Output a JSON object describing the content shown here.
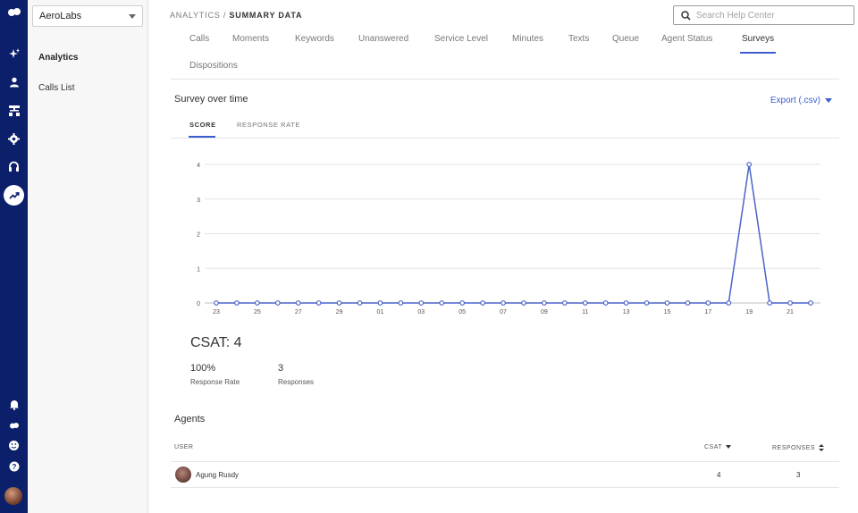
{
  "org_selector": {
    "value": "AeroLabs"
  },
  "sidebar": {
    "items": [
      {
        "label": "Analytics",
        "active": true
      },
      {
        "label": "Calls List",
        "active": false
      }
    ]
  },
  "rail_icons": [
    "logo-icon",
    "sparkle-icon",
    "user-icon",
    "org-chart-icon",
    "settings-icon",
    "headset-icon",
    "trending-icon",
    "bell-icon",
    "logo-small-icon",
    "smiley-icon",
    "help-icon"
  ],
  "header": {
    "breadcrumb_parent": "ANALYTICS",
    "breadcrumb_sep": "/",
    "breadcrumb_current": "SUMMARY DATA",
    "search_placeholder": "Search Help Center"
  },
  "tabs": [
    "Calls",
    "Moments",
    "Keywords",
    "Unanswered",
    "Service Level",
    "Minutes",
    "Texts",
    "Queue",
    "Agent Status",
    "Surveys",
    "Dispositions"
  ],
  "active_tab": "Surveys",
  "section": {
    "title": "Survey over time",
    "export_label": "Export (.csv)"
  },
  "subtabs": [
    {
      "label": "SCORE",
      "active": true
    },
    {
      "label": "RESPONSE RATE",
      "active": false
    }
  ],
  "chart_data": {
    "type": "line",
    "x": [
      "23",
      "24",
      "25",
      "26",
      "27",
      "28",
      "29",
      "30",
      "01",
      "02",
      "03",
      "04",
      "05",
      "06",
      "07",
      "08",
      "09",
      "10",
      "11",
      "12",
      "13",
      "14",
      "15",
      "16",
      "17",
      "18",
      "19",
      "20",
      "21",
      "22"
    ],
    "x_tick_labels": [
      "23",
      "25",
      "27",
      "29",
      "01",
      "03",
      "05",
      "07",
      "09",
      "11",
      "13",
      "15",
      "17",
      "19",
      "21"
    ],
    "series": [
      {
        "values": [
          0,
          0,
          0,
          0,
          0,
          0,
          0,
          0,
          0,
          0,
          0,
          0,
          0,
          0,
          0,
          0,
          0,
          0,
          0,
          0,
          0,
          0,
          0,
          0,
          0,
          0,
          4,
          0,
          0,
          0
        ]
      }
    ],
    "ylim": [
      0,
      4
    ],
    "y_ticks": [
      "0",
      "1",
      "2",
      "3",
      "4"
    ],
    "grid": true,
    "line_color": "#4a63c9",
    "title": "",
    "xlabel": "",
    "ylabel": ""
  },
  "summary": {
    "csat_label": "CSAT: 4",
    "response_rate_value": "100%",
    "response_rate_label": "Response Rate",
    "responses_value": "3",
    "responses_label": "Responses"
  },
  "agents": {
    "title": "Agents",
    "columns": {
      "user": "USER",
      "csat": "CSAT",
      "responses": "RESPONSES"
    },
    "rows": [
      {
        "name": "Agung Rusdy",
        "csat": "4",
        "responses": "3"
      }
    ]
  },
  "colors": {
    "rail": "#0b1f6b",
    "accent": "#3b5fd0"
  }
}
